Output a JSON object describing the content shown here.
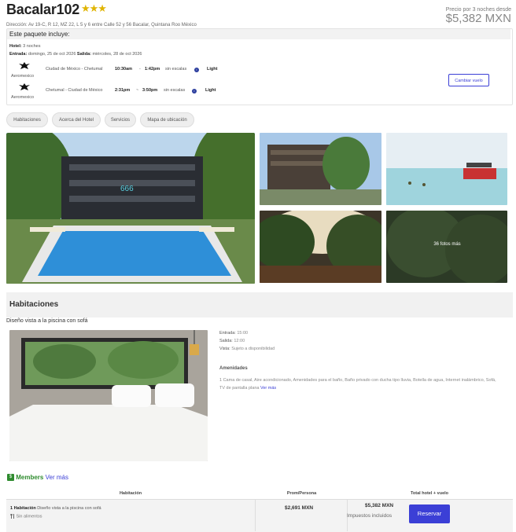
{
  "hotel": {
    "name": "Bacalar102",
    "stars": "★★★",
    "address": "Dirección: Av 19-C, R 12, MZ 22, L 5 y 6 entre Calle 52 y 56 Bacalar, Quintana Roo México",
    "price_label": "Precio por 3 noches desde",
    "price_value": "$5,382 MXN"
  },
  "package": {
    "heading": "Este paquete incluye:",
    "hotel_label": "Hotel:",
    "hotel_value": "3 noches",
    "checkin_label": "Entrada:",
    "checkin_value": "domingo, 25 de oct 2026",
    "checkout_label": "Salida:",
    "checkout_value": "miércoles, 28 de oct 2026",
    "flights": [
      {
        "airline": "Aeromexico",
        "route": "Ciudad de México - Chetumal",
        "depart": "10:30am",
        "arrive": "1:42pm",
        "stops": "sin escalas",
        "fare": "Light"
      },
      {
        "airline": "Aeromexico",
        "route": "Chetumal - Ciudad de México",
        "depart": "2:31pm",
        "arrive": "3:50pm",
        "stops": "sin escalas",
        "fare": "Light"
      }
    ],
    "dash": "-",
    "dash2": "~",
    "info_glyph": "i",
    "change_flight": "Cambiar vuelo"
  },
  "tabs": [
    "Habitaciones",
    "Acerca del Hotel",
    "Servicios",
    "Mapa de ubicación"
  ],
  "gallery": {
    "more_photos": "36 fotos más"
  },
  "rooms": {
    "section_title": "Habitaciones",
    "room_name": "Diseño vista a la piscina con sofá",
    "checkin_label": "Entrada:",
    "checkin_value": "15:00",
    "checkout_label": "Salida:",
    "checkout_value": "12:00",
    "view_label": "Vista:",
    "view_value": "Sujeto a disponibilidad",
    "amenities_title": "Amenidades",
    "amenities_text": "1 Cama de casal, Aire acondicionado, Amenidades para el baño, Baño privado con ducha tipo lluvia, Botella de agua, Internet inalámbrico, Sofá, TV de pantalla plana",
    "amenities_more": "Ver más"
  },
  "members": {
    "label": "Members",
    "more": "Ver más",
    "icon": "$"
  },
  "table": {
    "headers": [
      "Habitación",
      "Prom/Persona",
      "Total hotel + vuelo"
    ],
    "row": {
      "room_count": "1 Habitación",
      "room_desc": "Diseño vista a la piscina con sofá",
      "meal": "Sin alimentos",
      "per_person": "$2,691 MXN",
      "total": "$5,382 MXN",
      "tax_note": "Impuestos incluidos",
      "reserve": "Reservar"
    }
  },
  "colors": {
    "accent": "#3b3fd6",
    "members_green": "#2e8b2e",
    "star": "#e0b400"
  },
  "icons": {
    "airline": "aeromexico-eagle-icon",
    "info": "info-icon",
    "cutlery": "cutlery-icon",
    "members": "members-badge-icon"
  }
}
